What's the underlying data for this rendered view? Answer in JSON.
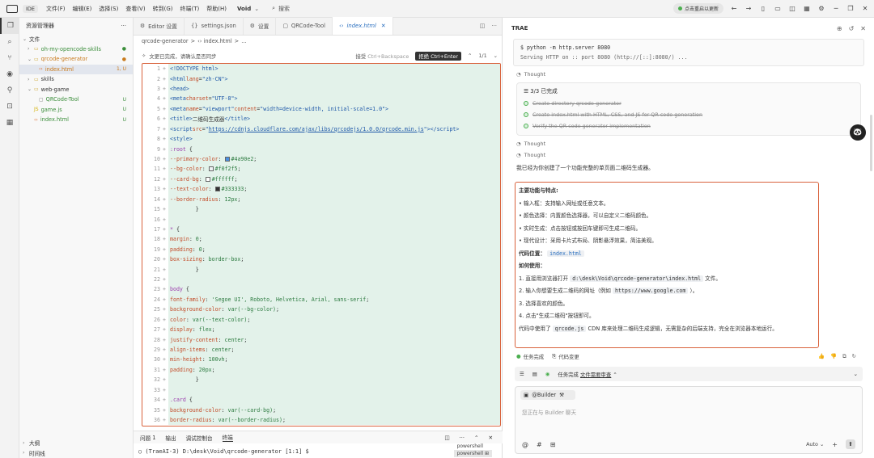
{
  "titlebar": {
    "badge": "IDE",
    "menu": [
      "文件(F)",
      "编辑(E)",
      "选择(S)",
      "查看(V)",
      "转到(G)",
      "终端(T)",
      "帮助(H)"
    ],
    "project": "Void",
    "search": "搜索",
    "update": "点击重启以更新"
  },
  "explorer": {
    "title": "资源管理器",
    "section": "文件",
    "items": [
      {
        "label": "oh-my-opencode-skills",
        "badge": "●",
        "indent": 1,
        "kind": "folder",
        "color": "green"
      },
      {
        "label": "qrcode-generator",
        "badge": "●",
        "indent": 1,
        "kind": "folder-open",
        "color": "orange"
      },
      {
        "label": "index.html",
        "badge": "1, U",
        "indent": 2,
        "kind": "html",
        "color": "orange",
        "selected": true
      },
      {
        "label": "skills",
        "badge": "",
        "indent": 1,
        "kind": "folder",
        "color": ""
      },
      {
        "label": "web-game",
        "badge": "",
        "indent": 1,
        "kind": "folder-open",
        "color": ""
      },
      {
        "label": "QRCode-Tool",
        "badge": "U",
        "indent": 2,
        "kind": "file",
        "color": "green"
      },
      {
        "label": "game.js",
        "badge": "U",
        "indent": 1,
        "kind": "js",
        "color": "green"
      },
      {
        "label": "index.html",
        "badge": "U",
        "indent": 1,
        "kind": "html",
        "color": "green"
      }
    ],
    "bottom": [
      "大纲",
      "时间线"
    ]
  },
  "tabs": [
    {
      "icon": "⚙",
      "label": "Editor 设置",
      "active": false
    },
    {
      "icon": "{}",
      "label": "settings.json",
      "active": false
    },
    {
      "icon": "⚙",
      "label": "设置",
      "active": false
    },
    {
      "icon": "▢",
      "label": "QRCode-Tool",
      "active": false
    },
    {
      "icon": "‹›",
      "label": "index.html",
      "active": true
    }
  ],
  "breadcrumb": [
    "qrcode-generator",
    ">",
    "‹› index.html",
    ">",
    "..."
  ],
  "diffbar": {
    "message": "文更已完成，请确认是否同步",
    "accept": "接受",
    "accept_key": "Ctrl+Backspace",
    "reject": "拒绝",
    "reject_key": "Ctrl+Enter",
    "page": "1/1"
  },
  "code_lines": [
    {
      "n": "1",
      "h": "<span class='tok-tag'>&lt;!DOCTYPE html&gt;</span>"
    },
    {
      "n": "2",
      "h": "<span class='tok-tag'>&lt;html</span> <span class='tok-attr'>lang</span>=<span class='tok-str'>\"zh-CN\"</span><span class='tok-tag'>&gt;</span>"
    },
    {
      "n": "3",
      "h": "<span class='tok-tag'>&lt;head&gt;</span>"
    },
    {
      "n": "4",
      "h": "    <span class='tok-tag'>&lt;meta</span> <span class='tok-attr'>charset</span>=<span class='tok-str'>\"UTF-8\"</span><span class='tok-tag'>&gt;</span>"
    },
    {
      "n": "5",
      "h": "    <span class='tok-tag'>&lt;meta</span> <span class='tok-attr'>name</span>=<span class='tok-str'>\"viewport\"</span> <span class='tok-attr'>content</span>=<span class='tok-str'>\"width=device-width, initial-scale=1.0\"</span><span class='tok-tag'>&gt;</span>"
    },
    {
      "n": "6",
      "h": "    <span class='tok-tag'>&lt;title&gt;</span>二维码生成器<span class='tok-tag'>&lt;/title&gt;</span>"
    },
    {
      "n": "7",
      "h": "    <span class='tok-tag'>&lt;script</span> <span class='tok-attr'>src</span>=<span class='tok-str'>\"</span><span class='tok-url'>https://cdnjs.cloudflare.com/ajax/libs/qrcodejs/1.0.0/qrcode.min.js</span><span class='tok-str'>\"</span><span class='tok-tag'>&gt;&lt;/script&gt;</span>"
    },
    {
      "n": "8",
      "h": "    <span class='tok-tag'>&lt;style&gt;</span>"
    },
    {
      "n": "9",
      "h": "        <span class='tok-sel'>:root</span> {"
    },
    {
      "n": "10",
      "h": "            <span class='tok-prop'>--primary-color</span>: <span class='sw' style='background:#4a90e2'></span><span class='tok-val'>#4a90e2</span>;"
    },
    {
      "n": "11",
      "h": "            <span class='tok-prop'>--bg-color</span>: <span class='sw' style='background:#f0f2f5'></span><span class='tok-val'>#f0f2f5</span>;"
    },
    {
      "n": "12",
      "h": "            <span class='tok-prop'>--card-bg</span>: <span class='sw' style='background:#ffffff'></span><span class='tok-val'>#ffffff</span>;"
    },
    {
      "n": "13",
      "h": "            <span class='tok-prop'>--text-color</span>: <span class='sw' style='background:#333333'></span><span class='tok-val'>#333333</span>;"
    },
    {
      "n": "14",
      "h": "            <span class='tok-prop'>--border-radius</span>: <span class='tok-val'>12px</span>;"
    },
    {
      "n": "15",
      "h": "        }"
    },
    {
      "n": "16",
      "h": ""
    },
    {
      "n": "17",
      "h": "        <span class='tok-sel'>*</span> {"
    },
    {
      "n": "18",
      "h": "            <span class='tok-prop'>margin</span>: <span class='tok-val'>0</span>;"
    },
    {
      "n": "19",
      "h": "            <span class='tok-prop'>padding</span>: <span class='tok-val'>0</span>;"
    },
    {
      "n": "20",
      "h": "            <span class='tok-prop'>box-sizing</span>: <span class='tok-val'>border-box</span>;"
    },
    {
      "n": "21",
      "h": "        }"
    },
    {
      "n": "22",
      "h": ""
    },
    {
      "n": "23",
      "h": "        <span class='tok-sel'>body</span> {"
    },
    {
      "n": "24",
      "h": "            <span class='tok-prop'>font-family</span>: <span class='tok-val'>'Segoe UI', Roboto, Helvetica, Arial, sans-serif</span>;"
    },
    {
      "n": "25",
      "h": "            <span class='tok-prop'>background-color</span>: <span class='tok-val'>var(--bg-color)</span>;"
    },
    {
      "n": "26",
      "h": "            <span class='tok-prop'>color</span>: <span class='tok-val'>var(--text-color)</span>;"
    },
    {
      "n": "27",
      "h": "            <span class='tok-prop'>display</span>: <span class='tok-val'>flex</span>;"
    },
    {
      "n": "28",
      "h": "            <span class='tok-prop'>justify-content</span>: <span class='tok-val'>center</span>;"
    },
    {
      "n": "29",
      "h": "            <span class='tok-prop'>align-items</span>: <span class='tok-val'>center</span>;"
    },
    {
      "n": "30",
      "h": "            <span class='tok-prop'>min-height</span>: <span class='tok-val'>100vh</span>;"
    },
    {
      "n": "31",
      "h": "            <span class='tok-prop'>padding</span>: <span class='tok-val'>20px</span>;"
    },
    {
      "n": "32",
      "h": "        }"
    },
    {
      "n": "33",
      "h": ""
    },
    {
      "n": "34",
      "h": "        <span class='tok-sel'>.card</span> {"
    },
    {
      "n": "35",
      "h": "            <span class='tok-prop'>background-color</span>: <span class='tok-val'>var(--card-bg)</span>;"
    },
    {
      "n": "36",
      "h": "            <span class='tok-prop'>border-radius</span>: <span class='tok-val'>var(--border-radius)</span>;"
    }
  ],
  "panel": {
    "tabs": [
      "问题",
      "1",
      "输出",
      "调试控制台",
      "终端"
    ],
    "terminal": "○ (TraeAI-3) D:\\desk\\Void\\qrcode-generator [1:1] $",
    "terminals": [
      "powershell",
      "powershell ⊞"
    ]
  },
  "chat": {
    "title": "TRAE",
    "command": "$ python -m http.server 8080",
    "command_out": "Serving HTTP on :: port 8080 (http://[::]:8080/) ...",
    "thought": "Thought",
    "tasks_head": "3/3 已完成",
    "tasks": [
      "Create directory qrcode-generator",
      "Create index.html with HTML, CSS, and JS for QR code generation",
      "Verify the QR code generator implementation"
    ],
    "summary": "我已经为你创建了一个功能完整的单页面二维码生成器。",
    "features_title": "主要功能与特点:",
    "features": [
      "输入框：支持输入网址或任意文本。",
      "颜色选择：内置颜色选择器，可以自定义二维码颜色。",
      "实时生成：点击按钮或按回车键即可生成二维码。",
      "现代设计：采用卡片式布局、阴影悬浮效果，简洁美观。"
    ],
    "code_loc_label": "代码位置：",
    "code_loc_file": "index.html",
    "howto_title": "如何使用：",
    "step1_a": "1. 直接用浏览器打开",
    "step1_code": "d:\\desk\\Void\\qrcode-generator\\index.html",
    "step1_b": "文件。",
    "step2_a": "2. 输入你想要生成二维码的网址（例如",
    "step2_code": "https://www.google.com",
    "step2_b": "）。",
    "step3": "3. 选择喜欢的颜色。",
    "step4": "4. 点击\"生成二维码\"按钮即可。",
    "footer_a": "代码中使用了",
    "footer_code": "qrcode.js",
    "footer_b": "CDN 库来处理二维码生成逻辑，无需复杂的后端支持，完全在浏览器本地运行。",
    "action_done": "任务完成",
    "action_diff": "代码变更",
    "status_done": "任务完成",
    "status_link": "文件需要审查",
    "builder": "@Builder",
    "input_placeholder": "您正在与 Builder 聊天",
    "auto": "Auto"
  }
}
